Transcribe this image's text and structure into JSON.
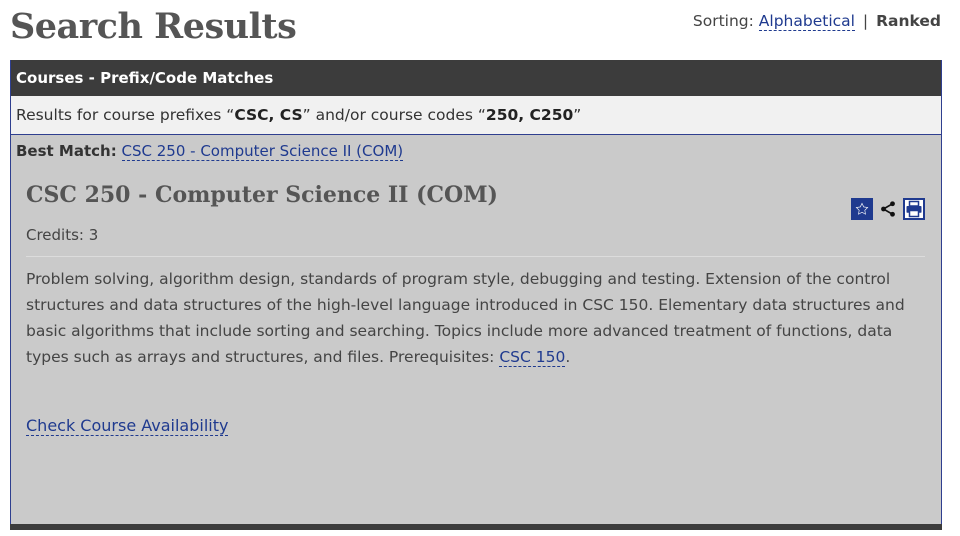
{
  "page": {
    "title": "Search Results"
  },
  "sorting": {
    "label": "Sorting:",
    "options": [
      "Alphabetical",
      "Ranked"
    ],
    "active": "Ranked",
    "separator": "|"
  },
  "panel": {
    "header": "Courses - Prefix/Code Matches",
    "results_for": {
      "prefix_text": "Results for course prefixes “",
      "prefixes": "CSC, CS",
      "middle_text": "” and/or course codes “",
      "codes": "250, C250",
      "suffix_text": "”"
    },
    "best_match": {
      "label": "Best Match:",
      "link": "CSC 250 - Computer Science II (COM)"
    },
    "course": {
      "title": "CSC 250 - Computer Science II (COM)",
      "credits": "Credits: 3",
      "description": "Problem solving, algorithm design, standards of program style, debugging and testing. Extension of the control structures and data structures of the high-level language introduced in CSC 150. Elementary data structures and basic algorithms that include sorting and searching. Topics include more advanced treatment of functions, data types such as arrays and structures, and files. Prerequisites: ",
      "prereq_link": "CSC 150",
      "description_end": ".",
      "availability_link": "Check Course Availability",
      "icons": [
        "star-icon",
        "share-icon",
        "print-icon"
      ]
    }
  },
  "colors": {
    "link": "#1f3a8f",
    "header_bg": "#3c3c3c",
    "panel_bg": "#cacaca"
  }
}
